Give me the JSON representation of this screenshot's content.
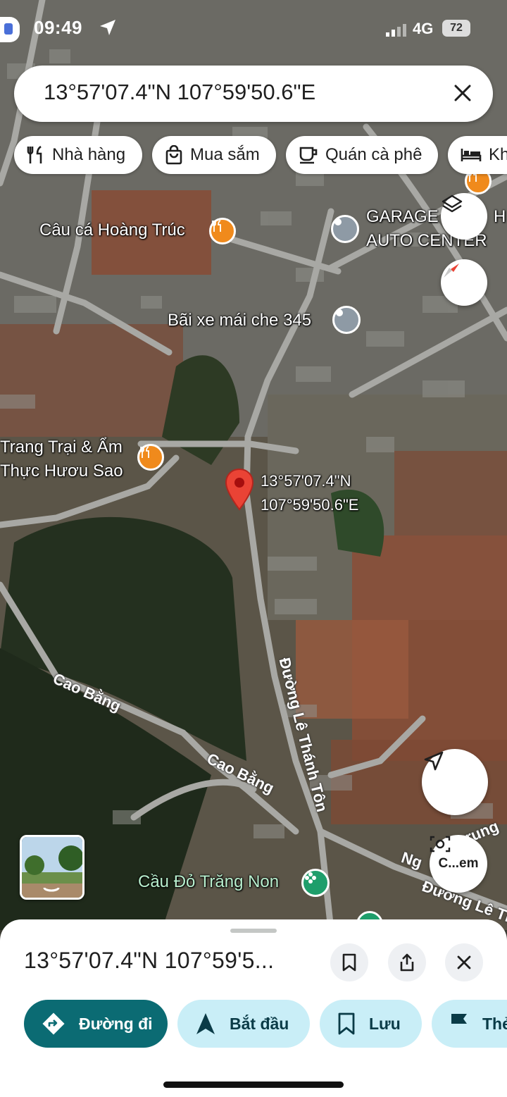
{
  "status_bar": {
    "time": "09:49",
    "network": "4G",
    "battery": "72"
  },
  "search": {
    "query": "13°57'07.4\"N 107°59'50.6\"E"
  },
  "chips": [
    {
      "label": "Nhà hàng",
      "icon": "restaurant-icon"
    },
    {
      "label": "Mua sắm",
      "icon": "shopping-bag-icon"
    },
    {
      "label": "Quán cà phê",
      "icon": "coffee-icon"
    },
    {
      "label": "Kh",
      "icon": "hotel-bed-icon"
    }
  ],
  "map": {
    "places": [
      {
        "name": "Câu cá Hoàng Trúc",
        "type": "restaurant"
      },
      {
        "name": "GARAGE",
        "type": "place"
      },
      {
        "name": "H",
        "type": "place"
      },
      {
        "name": "AUTO CENTER",
        "type": "place"
      },
      {
        "name": "Bãi xe mái che 345",
        "type": "place"
      },
      {
        "name": "Trang Trại & Ẩm",
        "type": "restaurant"
      },
      {
        "name": "Thực Hươu Sao",
        "type": "restaurant"
      },
      {
        "name": "Cầu Đỏ Trăng Non",
        "type": "park"
      }
    ],
    "pin_label_line1": "13°57'07.4\"N",
    "pin_label_line2": "107°59'50.6\"E",
    "roads": [
      "Cao Bằng",
      "Cao Bằng",
      "Đường Lê Thánh Tôn",
      "Ng",
      "rung",
      "Đường Lê Th"
    ],
    "street_view_button": "C...em",
    "colors": {
      "pin": "#ea4335",
      "restaurant_poi": "#f08a1c",
      "park_poi": "#1e9e6b"
    }
  },
  "sheet": {
    "title": "13°57'07.4\"N 107°59'5...",
    "actions": [
      {
        "label": "Đường đi",
        "icon": "directions-icon",
        "style": "primary"
      },
      {
        "label": "Bắt đầu",
        "icon": "navigation-arrow-icon",
        "style": "tonal"
      },
      {
        "label": "Lưu",
        "icon": "bookmark-icon",
        "style": "tonal"
      },
      {
        "label": "Thẻ",
        "icon": "flag-icon",
        "style": "tonal"
      }
    ]
  }
}
